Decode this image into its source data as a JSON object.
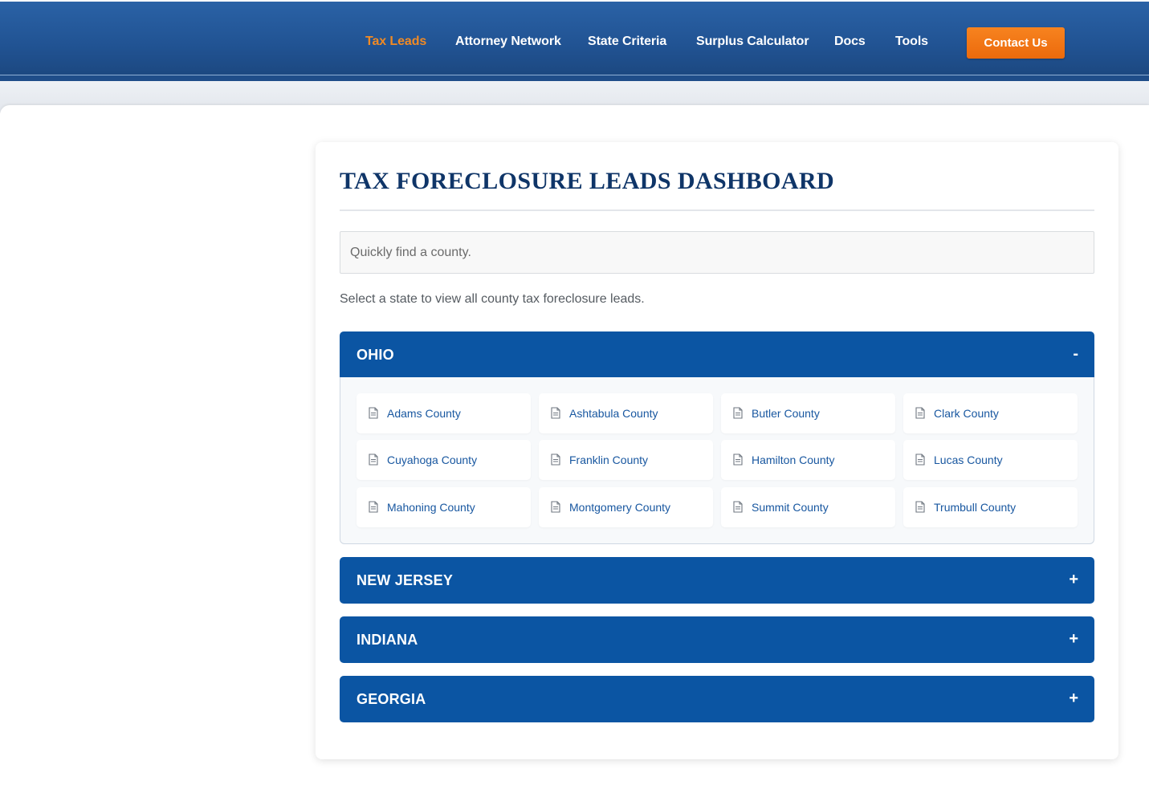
{
  "nav": {
    "items": [
      {
        "label": "Tax Leads",
        "active": true
      },
      {
        "label": "Attorney Network",
        "active": false
      },
      {
        "label": "State Criteria",
        "active": false
      },
      {
        "label": "Surplus Calculator",
        "active": false
      },
      {
        "label": "Docs",
        "active": false
      },
      {
        "label": "Tools",
        "active": false
      }
    ],
    "contact_label": "Contact Us"
  },
  "dashboard": {
    "title": "TAX FORECLOSURE LEADS DASHBOARD",
    "search_placeholder": "Quickly find a county.",
    "intro": "Select a state to view all county tax foreclosure leads."
  },
  "states": [
    {
      "name": "OHIO",
      "toggle": "-",
      "expanded": true,
      "counties": [
        "Adams County",
        "Ashtabula County",
        "Butler County",
        "Clark County",
        "Cuyahoga County",
        "Franklin County",
        "Hamilton County",
        "Lucas County",
        "Mahoning County",
        "Montgomery County",
        "Summit County",
        "Trumbull County"
      ]
    },
    {
      "name": "NEW JERSEY",
      "toggle": "+",
      "expanded": false
    },
    {
      "name": "INDIANA",
      "toggle": "+",
      "expanded": false
    },
    {
      "name": "GEORGIA",
      "toggle": "+",
      "expanded": false
    }
  ],
  "colors": {
    "header_blue": "#215393",
    "accent_orange": "#f08a24",
    "state_blue": "#0b55a3",
    "title_navy": "#0f3568",
    "link_blue": "#1857a0"
  },
  "icons": {
    "county_icon": "document-icon"
  }
}
